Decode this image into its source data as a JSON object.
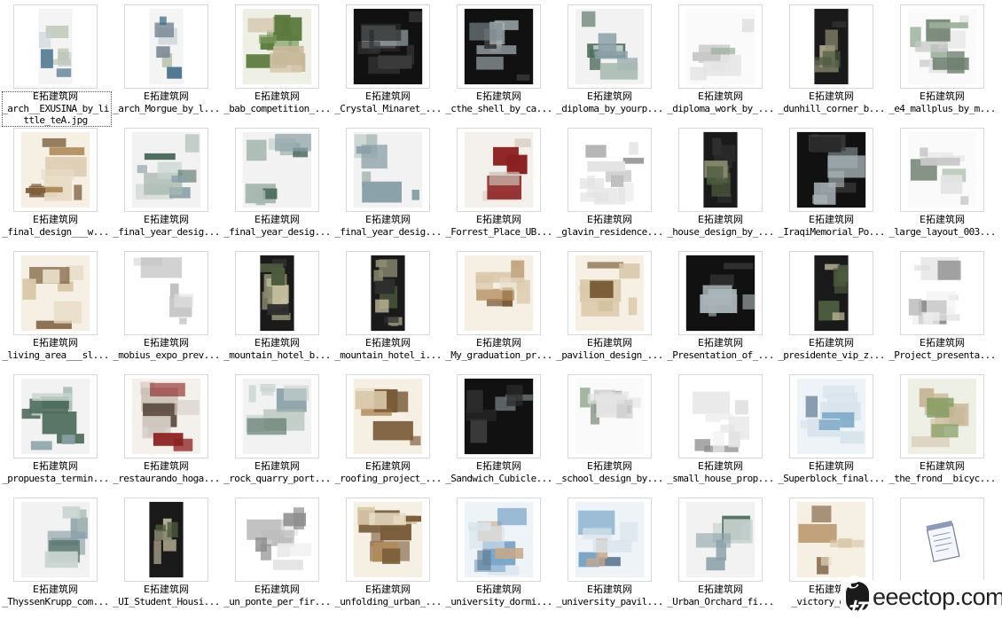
{
  "watermark": {
    "logo": "e拓",
    "text": "eeectop.com"
  },
  "items": [
    {
      "site": "E拓建筑网",
      "name": "_arch__EXUSINA_by_little_teA.jpg",
      "theme": "vert",
      "selected": true
    },
    {
      "site": "E拓建筑网",
      "name": "_arch_Morgue_by_l...",
      "theme": "vert"
    },
    {
      "site": "E拓建筑网",
      "name": "_bab_competition_...",
      "theme": "green"
    },
    {
      "site": "E拓建筑网",
      "name": "_Crystal_Minaret_...",
      "theme": "dark"
    },
    {
      "site": "E拓建筑网",
      "name": "_cthe_shell_by_ca...",
      "theme": "dark"
    },
    {
      "site": "E拓建筑网",
      "name": "_diploma_by_yourp...",
      "theme": "land"
    },
    {
      "site": "E拓建筑网",
      "name": "_diploma_work_by_...",
      "theme": "light"
    },
    {
      "site": "E拓建筑网",
      "name": "_dunhill_corner_b...",
      "theme": "darkvert"
    },
    {
      "site": "E拓建筑网",
      "name": "_e4_mallplus_by_m...",
      "theme": "light"
    },
    {
      "site": "E拓建筑网",
      "name": "_final_design___w...",
      "theme": "sepia"
    },
    {
      "site": "E拓建筑网",
      "name": "_final_year_desig...",
      "theme": "land"
    },
    {
      "site": "E拓建筑网",
      "name": "_final_year_desig...",
      "theme": "land"
    },
    {
      "site": "E拓建筑网",
      "name": "_final_year_desig...",
      "theme": "land"
    },
    {
      "site": "E拓建筑网",
      "name": "_Forrest_Place_UB...",
      "theme": "red"
    },
    {
      "site": "E拓建筑网",
      "name": "_glavin_residence...",
      "theme": "sketch"
    },
    {
      "site": "E拓建筑网",
      "name": "_house_design_by_...",
      "theme": "darkvert"
    },
    {
      "site": "E拓建筑网",
      "name": "_IraqiMemorial_Po...",
      "theme": "dark"
    },
    {
      "site": "E拓建筑网",
      "name": "_large_layout_003...",
      "theme": "light"
    },
    {
      "site": "E拓建筑网",
      "name": "_living_area___sl...",
      "theme": "sepia"
    },
    {
      "site": "E拓建筑网",
      "name": "_mobius_expo_prev...",
      "theme": "sketch"
    },
    {
      "site": "E拓建筑网",
      "name": "_mountain_hotel_b...",
      "theme": "darkvert"
    },
    {
      "site": "E拓建筑网",
      "name": "_mountain_hotel_i...",
      "theme": "darkvert"
    },
    {
      "site": "E拓建筑网",
      "name": "_My_graduation_pr...",
      "theme": "sepia"
    },
    {
      "site": "E拓建筑网",
      "name": "_pavilion_design_...",
      "theme": "sepia"
    },
    {
      "site": "E拓建筑网",
      "name": "_Presentation_of_...",
      "theme": "dark"
    },
    {
      "site": "E拓建筑网",
      "name": "_presidente_vip_z...",
      "theme": "darkvert"
    },
    {
      "site": "E拓建筑网",
      "name": "_Project_presenta...",
      "theme": "sketch"
    },
    {
      "site": "E拓建筑网",
      "name": "_propuesta_termin...",
      "theme": "land"
    },
    {
      "site": "E拓建筑网",
      "name": "_restaurando_hoga...",
      "theme": "red"
    },
    {
      "site": "E拓建筑网",
      "name": "_rock_quarry_port...",
      "theme": "land"
    },
    {
      "site": "E拓建筑网",
      "name": "_roofing_project_...",
      "theme": "sepia"
    },
    {
      "site": "E拓建筑网",
      "name": "_Sandwich_Cubicle...",
      "theme": "dark"
    },
    {
      "site": "E拓建筑网",
      "name": "_school_design_by...",
      "theme": "light"
    },
    {
      "site": "E拓建筑网",
      "name": "_small_house_prop...",
      "theme": "sketch"
    },
    {
      "site": "E拓建筑网",
      "name": "_Superblock_final...",
      "theme": "sky"
    },
    {
      "site": "E拓建筑网",
      "name": "_the_frond__bicyc...",
      "theme": "green"
    },
    {
      "site": "E拓建筑网",
      "name": "_ThyssenKrupp_com...",
      "theme": "land"
    },
    {
      "site": "E拓建筑网",
      "name": "_UI_Student_Housi...",
      "theme": "darkvert"
    },
    {
      "site": "E拓建筑网",
      "name": "_un_ponte_per_fir...",
      "theme": "sketch"
    },
    {
      "site": "E拓建筑网",
      "name": "_unfolding_urban_...",
      "theme": "sepia"
    },
    {
      "site": "E拓建筑网",
      "name": "_university_dormi...",
      "theme": "sky"
    },
    {
      "site": "E拓建筑网",
      "name": "_university_pavil...",
      "theme": "sky"
    },
    {
      "site": "E拓建筑网",
      "name": "_Urban_Orchard_fi...",
      "theme": "land"
    },
    {
      "site": "E拓建筑网",
      "name": "_victory_day...",
      "theme": "sepia"
    },
    {
      "site": "",
      "name": "",
      "theme": "notepad"
    }
  ]
}
